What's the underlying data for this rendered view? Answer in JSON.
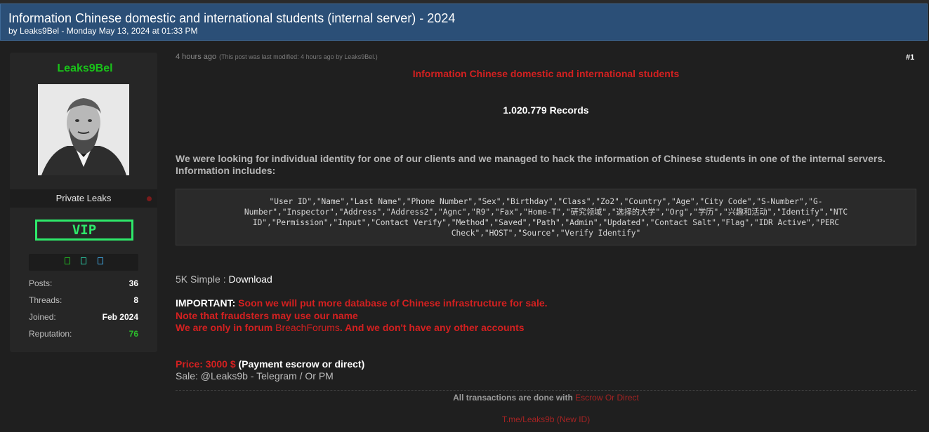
{
  "thread": {
    "title": "Information Chinese domestic and international students (internal server) - 2024",
    "byline": "by Leaks9Bel - Monday May 13, 2024 at 01:33 PM"
  },
  "profile": {
    "username": "Leaks9Bel",
    "user_icon": "",
    "rank_title": "Private Leaks",
    "vip_label": "VIP",
    "badges": [
      {
        "icon": "badge-green-icon",
        "glyph": "",
        "color": "#22b422"
      },
      {
        "icon": "badge-teal-icon",
        "glyph": "",
        "color": "#2bc4a0"
      },
      {
        "icon": "badge-blue-icon",
        "glyph": "",
        "color": "#3fa1d9"
      }
    ],
    "stats": [
      {
        "label": "Posts:",
        "value": "36"
      },
      {
        "label": "Threads:",
        "value": "8"
      },
      {
        "label": "Joined:",
        "value": "Feb 2024"
      },
      {
        "label": "Reputation:",
        "value": "76"
      }
    ]
  },
  "post": {
    "time": "4 hours ago",
    "modified": "(This post was last modified: 4 hours ago by Leaks9Bel.)",
    "number": "#1",
    "headline": "Information Chinese domestic and international students",
    "records": "1.020.779 Records",
    "intro_line1": "We were looking for individual identity for one of our clients and we managed to hack the information of Chinese students in one of the internal servers.",
    "intro_line2": "Information includes:",
    "fields": "\"User ID\",\"Name\",\"Last Name\",\"Phone Number\",\"Sex\",\"Birthday\",\"Class\",\"Zo2\",\"Country\",\"Age\",\"City Code\",\"S-Number\",\"G-Number\",\"Inspector\",\"Address\",\"Address2\",\"Agnc\",\"R9\",\"Fax\",\"Home-T\",\"研究领域\",\"选择的大学\",\"Org\",\"学历\",\"兴趣和活动\",\"Identify\",\"NTC ID\",\"Permission\",\"Input\",\"Contact Verify\",\"Method\",\"Saved\",\"Path\",\"Admin\",\"Updated\",\"Contact Salt\",\"Flag\",\"IDR Active\",\"PERC Check\",\"HOST\",\"Source\",\"Verify Identify\"",
    "sample_label": "5K Simple : ",
    "download_label": "Download",
    "important_label": "IMPORTANT:",
    "important_text": " Soon we will put more database of Chinese infrastructure for sale.",
    "note_text": "Note that fraudsters may use our name",
    "forum_prefix": "We are only in forum ",
    "forum_name": "BreachForums",
    "forum_suffix": ". And we don't have any other accounts",
    "price_label": "Price: 3000 $",
    "price_suffix": " (Payment escrow or direct)",
    "sale_text": "Sale: @Leaks9b - Telegram / Or PM",
    "transactions_text": "All transactions are done with ",
    "escrow_link": "Escrow Or Direct",
    "telegram_link": "T.me/Leaks9b (New ID)"
  }
}
